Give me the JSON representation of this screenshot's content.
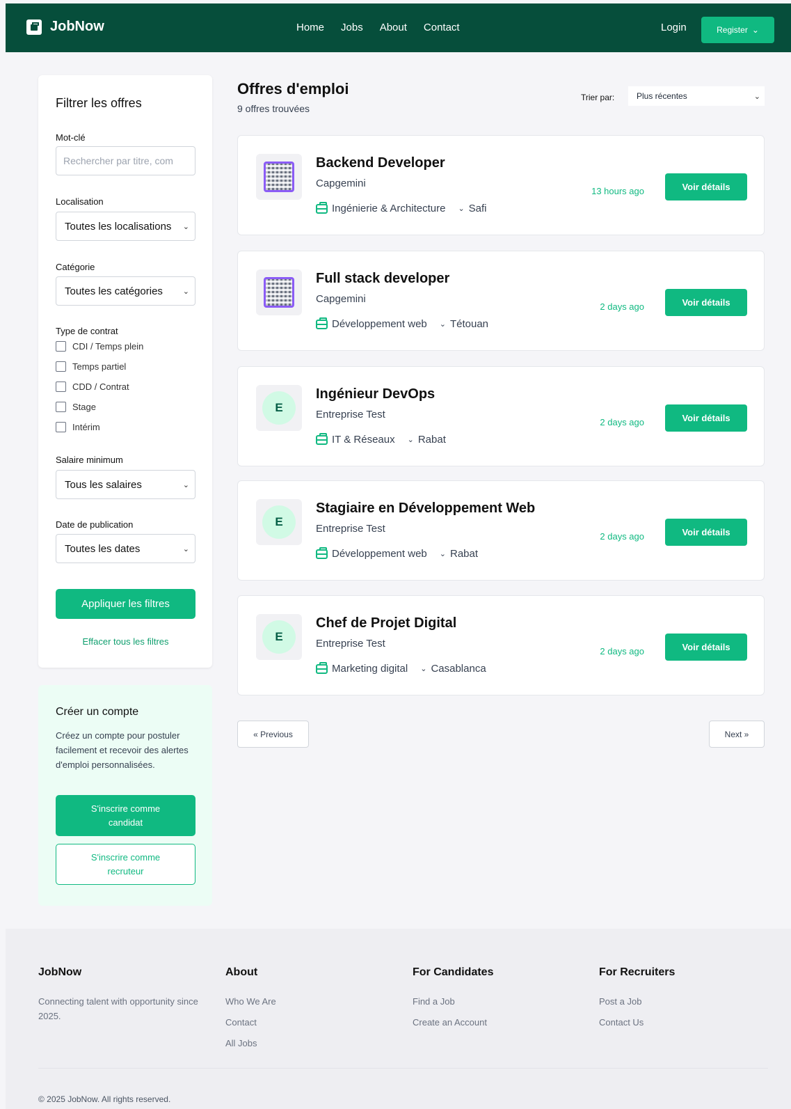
{
  "nav": {
    "brand": "JobNow",
    "links": [
      "Home",
      "Jobs",
      "About",
      "Contact"
    ],
    "login": "Login",
    "register": "Register"
  },
  "filters": {
    "title": "Filtrer les offres",
    "keyword_label": "Mot-clé",
    "keyword_placeholder": "Rechercher par titre, com",
    "location_label": "Localisation",
    "location_value": "Toutes les localisations",
    "category_label": "Catégorie",
    "category_value": "Toutes les catégories",
    "contract_label": "Type de contrat",
    "contracts": [
      "CDI / Temps plein",
      "Temps partiel",
      "CDD / Contrat",
      "Stage",
      "Intérim"
    ],
    "salary_label": "Salaire minimum",
    "salary_value": "Tous les salaires",
    "date_label": "Date de publication",
    "date_value": "Toutes les dates",
    "apply": "Appliquer les filtres",
    "clear": "Effacer tous les filtres"
  },
  "promo": {
    "title": "Créer un compte",
    "text": "Créez un compte pour postuler facilement et recevoir des alertes d'emploi personnalisées.",
    "candidate_btn": "S'inscrire comme candidat",
    "recruiter_btn": "S'inscrire comme recruteur"
  },
  "main": {
    "title": "Offres d'emploi",
    "count": "9 offres trouvées",
    "sort_label": "Trier par:",
    "sort_value": "Plus récentes",
    "details_label": "Voir détails",
    "jobs": [
      {
        "title": "Backend Developer",
        "company": "Capgemini",
        "category": "Ingénierie & Architecture",
        "city": "Safi",
        "ago": "13 hours ago",
        "logo": "qr-logo"
      },
      {
        "title": "Full stack developer",
        "company": "Capgemini",
        "category": "Développement web",
        "city": "Tétouan",
        "ago": "2 days ago",
        "logo": "qr-logo"
      },
      {
        "title": "Ingénieur DevOps",
        "company": "Entreprise Test",
        "category": "IT & Réseaux",
        "city": "Rabat",
        "ago": "2 days ago",
        "logo": "E"
      },
      {
        "title": "Stagiaire en Développement Web",
        "company": "Entreprise Test",
        "category": "Développement web",
        "city": "Rabat",
        "ago": "2 days ago",
        "logo": "E"
      },
      {
        "title": "Chef de Projet Digital",
        "company": "Entreprise Test",
        "category": "Marketing digital",
        "city": "Casablanca",
        "ago": "2 days ago",
        "logo": "E"
      }
    ],
    "prev": "« Previous",
    "next": "Next »"
  },
  "footer": {
    "brand": "JobNow",
    "tagline": "Connecting talent with opportunity since 2025.",
    "about_head": "About",
    "about_links": [
      "Who We Are",
      "Contact",
      "All Jobs"
    ],
    "cand_head": "For Candidates",
    "cand_links": [
      "Find a Job",
      "Create an Account"
    ],
    "rec_head": "For Recruiters",
    "rec_links": [
      "Post a Job",
      "Contact Us"
    ],
    "copyright": "© 2025 JobNow. All rights reserved."
  },
  "colors": {
    "nav_bg": "#064e3b",
    "accent": "#10b981",
    "promo_bg": "#ecfdf5"
  }
}
